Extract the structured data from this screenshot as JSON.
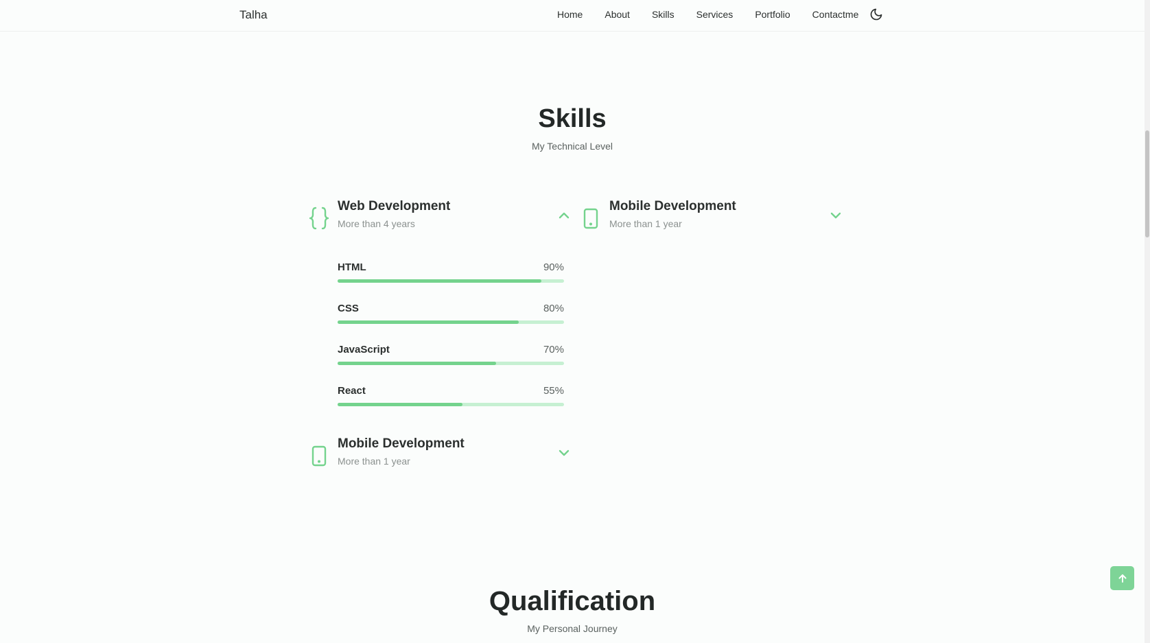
{
  "header": {
    "logo": "Talha",
    "nav": [
      "Home",
      "About",
      "Skills",
      "Services",
      "Portfolio",
      "Contactme"
    ],
    "theme_icon": "moon-icon"
  },
  "skills": {
    "title": "Skills",
    "subtitle": "My Technical Level",
    "web": {
      "title": "Web Development",
      "years": "More than 4 years",
      "icon": "code-braces-icon",
      "expanded": true,
      "items": [
        {
          "name": "HTML",
          "percent_label": "90%",
          "level": 0.9
        },
        {
          "name": "CSS",
          "percent_label": "80%",
          "level": 0.8
        },
        {
          "name": "JavaScript",
          "percent_label": "70%",
          "level": 0.7
        },
        {
          "name": "React",
          "percent_label": "55%",
          "level": 0.55
        }
      ]
    },
    "mobile_right": {
      "title": "Mobile Development",
      "years": "More than 1 year",
      "icon": "smartphone-icon"
    },
    "mobile_left": {
      "title": "Mobile Development",
      "years": "More than 1 year",
      "icon": "smartphone-icon"
    }
  },
  "qualification": {
    "title": "Qualification",
    "subtitle": "My Personal Journey"
  },
  "colors": {
    "accent": "#74d38d",
    "accent_light": "#c6f0d2",
    "text": "#2b2f2e"
  }
}
